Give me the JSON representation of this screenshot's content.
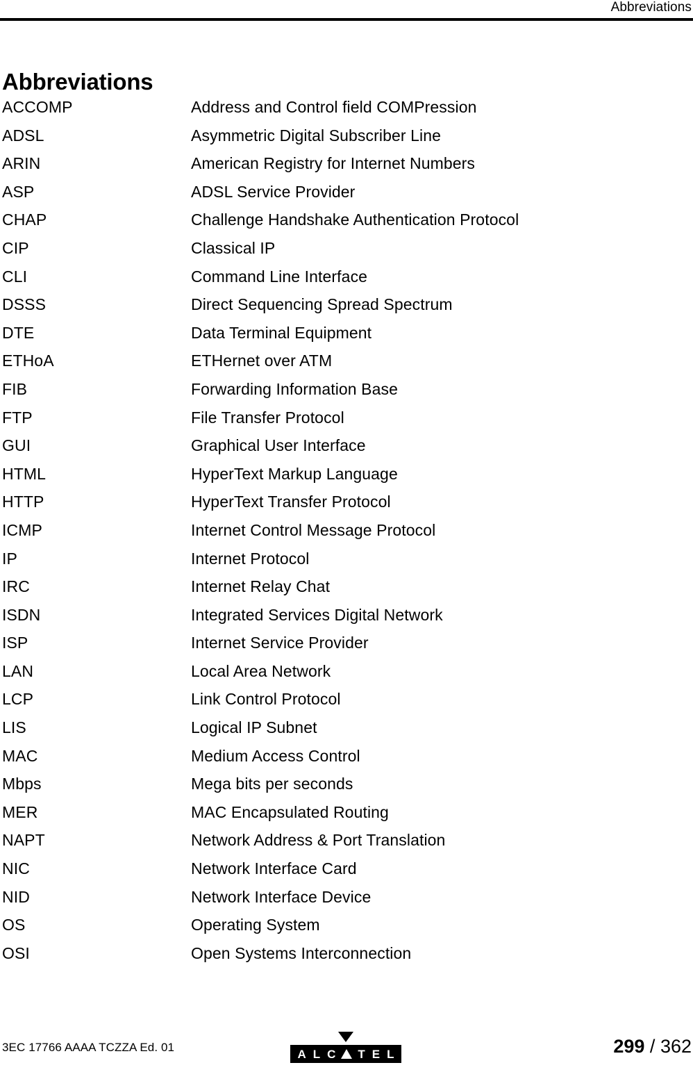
{
  "header": {
    "running_head": "Abbreviations"
  },
  "title": "Abbreviations",
  "abbreviations": [
    {
      "term": "ACCOMP",
      "definition": "Address and Control field COMPression"
    },
    {
      "term": "ADSL",
      "definition": "Asymmetric Digital Subscriber Line"
    },
    {
      "term": "ARIN",
      "definition": "American Registry for Internet Numbers"
    },
    {
      "term": "ASP",
      "definition": "ADSL Service Provider"
    },
    {
      "term": "CHAP",
      "definition": "Challenge Handshake Authentication Protocol"
    },
    {
      "term": "CIP",
      "definition": "Classical IP"
    },
    {
      "term": "CLI",
      "definition": "Command Line Interface"
    },
    {
      "term": "DSSS",
      "definition": "Direct Sequencing Spread Spectrum"
    },
    {
      "term": "DTE",
      "definition": "Data Terminal Equipment"
    },
    {
      "term": "ETHoA",
      "definition": "ETHernet over ATM"
    },
    {
      "term": "FIB",
      "definition": "Forwarding Information Base"
    },
    {
      "term": "FTP",
      "definition": "File Transfer Protocol"
    },
    {
      "term": "GUI",
      "definition": "Graphical User Interface"
    },
    {
      "term": "HTML",
      "definition": "HyperText Markup Language"
    },
    {
      "term": "HTTP",
      "definition": "HyperText Transfer Protocol"
    },
    {
      "term": "ICMP",
      "definition": "Internet Control Message Protocol"
    },
    {
      "term": "IP",
      "definition": "Internet Protocol"
    },
    {
      "term": "IRC",
      "definition": "Internet Relay Chat"
    },
    {
      "term": "ISDN",
      "definition": "Integrated Services Digital Network"
    },
    {
      "term": "ISP",
      "definition": "Internet Service Provider"
    },
    {
      "term": "LAN",
      "definition": "Local Area Network"
    },
    {
      "term": "LCP",
      "definition": "Link Control Protocol"
    },
    {
      "term": "LIS",
      "definition": "Logical IP Subnet"
    },
    {
      "term": "MAC",
      "definition": "Medium Access Control"
    },
    {
      "term": "Mbps",
      "definition": "Mega bits per seconds"
    },
    {
      "term": "MER",
      "definition": "MAC Encapsulated Routing"
    },
    {
      "term": "NAPT",
      "definition": "Network Address & Port Translation"
    },
    {
      "term": "NIC",
      "definition": "Network Interface Card"
    },
    {
      "term": "NID",
      "definition": "Network Interface Device"
    },
    {
      "term": "OS",
      "definition": "Operating System"
    },
    {
      "term": "OSI",
      "definition": "Open Systems Interconnection"
    }
  ],
  "footer": {
    "document_id": "3EC 17766 AAAA TCZZA Ed. 01",
    "logo": {
      "name": "alcatel-logo",
      "letters": [
        "A",
        "L",
        "C",
        "triangle",
        "T",
        "E",
        "L"
      ],
      "wordmark": "ALCATEL",
      "background_color": "#000000",
      "text_color": "#ffffff"
    },
    "pagination": {
      "current_page": "299",
      "separator": "/",
      "total_pages": "362"
    }
  }
}
